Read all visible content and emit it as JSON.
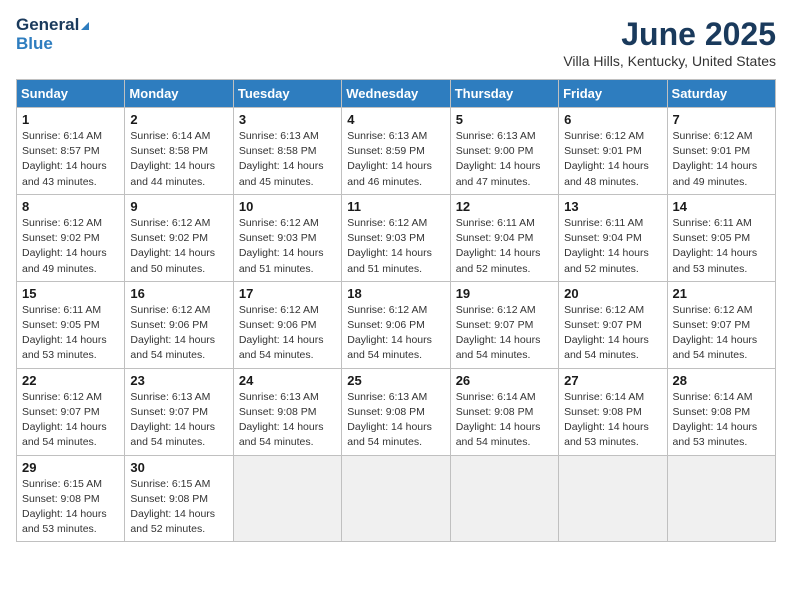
{
  "header": {
    "logo_line1": "General",
    "logo_line2": "Blue",
    "month": "June 2025",
    "location": "Villa Hills, Kentucky, United States"
  },
  "weekdays": [
    "Sunday",
    "Monday",
    "Tuesday",
    "Wednesday",
    "Thursday",
    "Friday",
    "Saturday"
  ],
  "weeks": [
    [
      {
        "day": 1,
        "sunrise": "6:14 AM",
        "sunset": "8:57 PM",
        "daylight": "14 hours and 43 minutes."
      },
      {
        "day": 2,
        "sunrise": "6:14 AM",
        "sunset": "8:58 PM",
        "daylight": "14 hours and 44 minutes."
      },
      {
        "day": 3,
        "sunrise": "6:13 AM",
        "sunset": "8:58 PM",
        "daylight": "14 hours and 45 minutes."
      },
      {
        "day": 4,
        "sunrise": "6:13 AM",
        "sunset": "8:59 PM",
        "daylight": "14 hours and 46 minutes."
      },
      {
        "day": 5,
        "sunrise": "6:13 AM",
        "sunset": "9:00 PM",
        "daylight": "14 hours and 47 minutes."
      },
      {
        "day": 6,
        "sunrise": "6:12 AM",
        "sunset": "9:01 PM",
        "daylight": "14 hours and 48 minutes."
      },
      {
        "day": 7,
        "sunrise": "6:12 AM",
        "sunset": "9:01 PM",
        "daylight": "14 hours and 49 minutes."
      }
    ],
    [
      {
        "day": 8,
        "sunrise": "6:12 AM",
        "sunset": "9:02 PM",
        "daylight": "14 hours and 49 minutes."
      },
      {
        "day": 9,
        "sunrise": "6:12 AM",
        "sunset": "9:02 PM",
        "daylight": "14 hours and 50 minutes."
      },
      {
        "day": 10,
        "sunrise": "6:12 AM",
        "sunset": "9:03 PM",
        "daylight": "14 hours and 51 minutes."
      },
      {
        "day": 11,
        "sunrise": "6:12 AM",
        "sunset": "9:03 PM",
        "daylight": "14 hours and 51 minutes."
      },
      {
        "day": 12,
        "sunrise": "6:11 AM",
        "sunset": "9:04 PM",
        "daylight": "14 hours and 52 minutes."
      },
      {
        "day": 13,
        "sunrise": "6:11 AM",
        "sunset": "9:04 PM",
        "daylight": "14 hours and 52 minutes."
      },
      {
        "day": 14,
        "sunrise": "6:11 AM",
        "sunset": "9:05 PM",
        "daylight": "14 hours and 53 minutes."
      }
    ],
    [
      {
        "day": 15,
        "sunrise": "6:11 AM",
        "sunset": "9:05 PM",
        "daylight": "14 hours and 53 minutes."
      },
      {
        "day": 16,
        "sunrise": "6:12 AM",
        "sunset": "9:06 PM",
        "daylight": "14 hours and 54 minutes."
      },
      {
        "day": 17,
        "sunrise": "6:12 AM",
        "sunset": "9:06 PM",
        "daylight": "14 hours and 54 minutes."
      },
      {
        "day": 18,
        "sunrise": "6:12 AM",
        "sunset": "9:06 PM",
        "daylight": "14 hours and 54 minutes."
      },
      {
        "day": 19,
        "sunrise": "6:12 AM",
        "sunset": "9:07 PM",
        "daylight": "14 hours and 54 minutes."
      },
      {
        "day": 20,
        "sunrise": "6:12 AM",
        "sunset": "9:07 PM",
        "daylight": "14 hours and 54 minutes."
      },
      {
        "day": 21,
        "sunrise": "6:12 AM",
        "sunset": "9:07 PM",
        "daylight": "14 hours and 54 minutes."
      }
    ],
    [
      {
        "day": 22,
        "sunrise": "6:12 AM",
        "sunset": "9:07 PM",
        "daylight": "14 hours and 54 minutes."
      },
      {
        "day": 23,
        "sunrise": "6:13 AM",
        "sunset": "9:07 PM",
        "daylight": "14 hours and 54 minutes."
      },
      {
        "day": 24,
        "sunrise": "6:13 AM",
        "sunset": "9:08 PM",
        "daylight": "14 hours and 54 minutes."
      },
      {
        "day": 25,
        "sunrise": "6:13 AM",
        "sunset": "9:08 PM",
        "daylight": "14 hours and 54 minutes."
      },
      {
        "day": 26,
        "sunrise": "6:14 AM",
        "sunset": "9:08 PM",
        "daylight": "14 hours and 54 minutes."
      },
      {
        "day": 27,
        "sunrise": "6:14 AM",
        "sunset": "9:08 PM",
        "daylight": "14 hours and 53 minutes."
      },
      {
        "day": 28,
        "sunrise": "6:14 AM",
        "sunset": "9:08 PM",
        "daylight": "14 hours and 53 minutes."
      }
    ],
    [
      {
        "day": 29,
        "sunrise": "6:15 AM",
        "sunset": "9:08 PM",
        "daylight": "14 hours and 53 minutes."
      },
      {
        "day": 30,
        "sunrise": "6:15 AM",
        "sunset": "9:08 PM",
        "daylight": "14 hours and 52 minutes."
      },
      null,
      null,
      null,
      null,
      null
    ]
  ]
}
